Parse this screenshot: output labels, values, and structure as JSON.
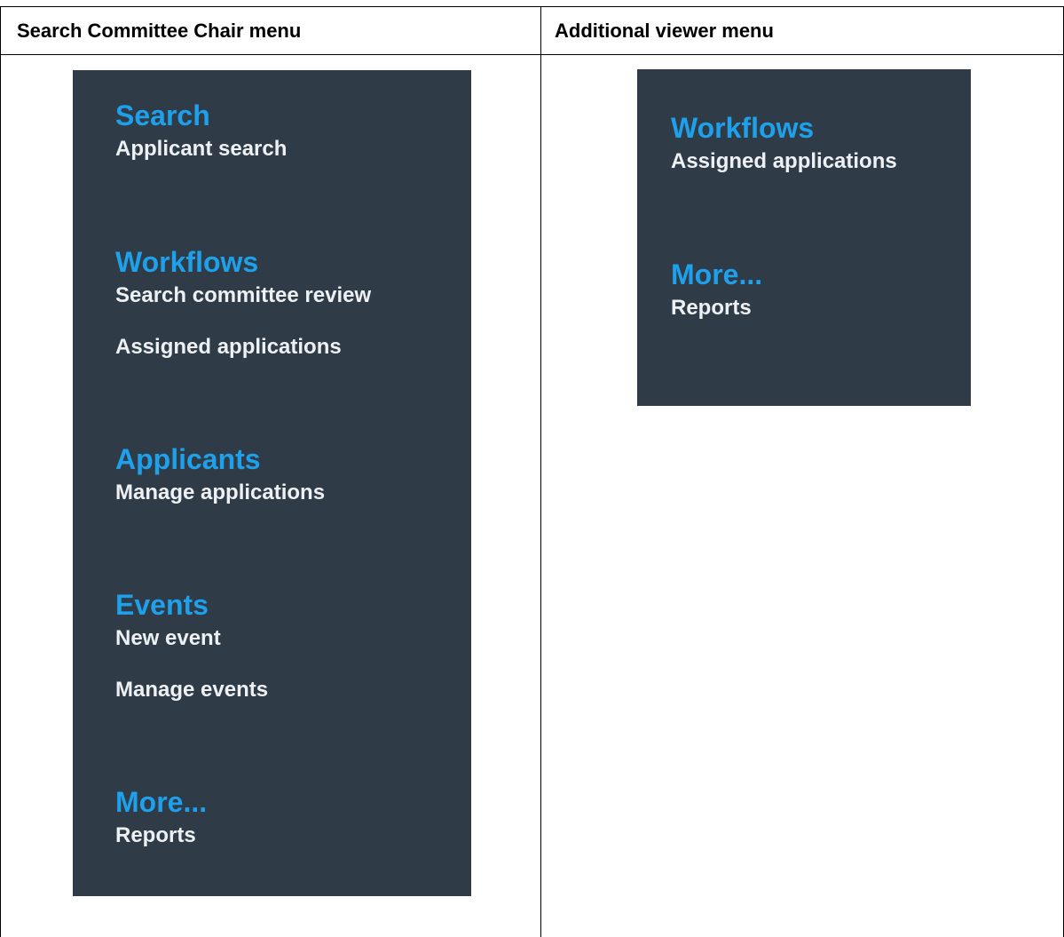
{
  "columns": [
    {
      "header": "Search Committee Chair menu",
      "sections": [
        {
          "title": "Search",
          "items": [
            "Applicant search"
          ]
        },
        {
          "title": "Workflows",
          "items": [
            "Search committee review",
            "Assigned applications"
          ]
        },
        {
          "title": "Applicants",
          "items": [
            "Manage applications"
          ]
        },
        {
          "title": "Events",
          "items": [
            "New event",
            "Manage events"
          ]
        },
        {
          "title": "More...",
          "items": [
            "Reports"
          ]
        }
      ]
    },
    {
      "header": "Additional viewer menu",
      "sections": [
        {
          "title": "Workflows",
          "items": [
            "Assigned applications"
          ]
        },
        {
          "title": "More...",
          "items": [
            "Reports"
          ]
        }
      ]
    }
  ],
  "colors": {
    "panel_bg": "#2f3b47",
    "section_title": "#1ea0ea",
    "menu_item": "#eef1f4"
  }
}
